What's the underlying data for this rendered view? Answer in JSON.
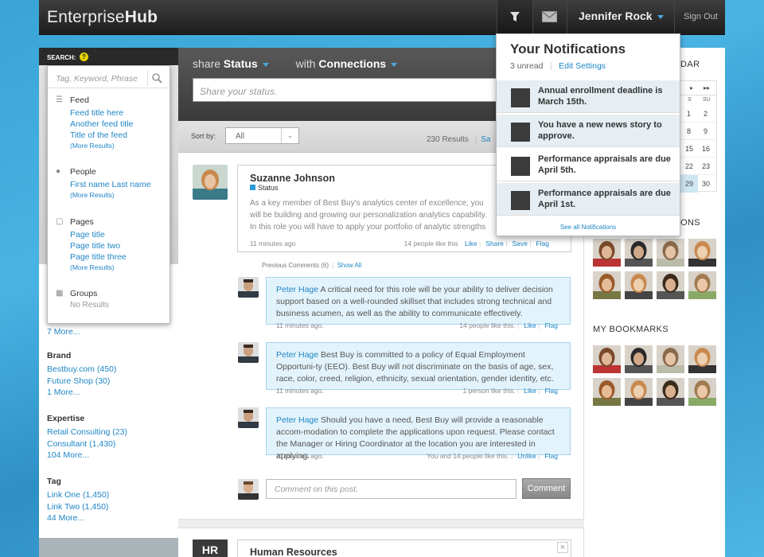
{
  "header": {
    "logo_light": "Enterprise",
    "logo_bold": "Hub",
    "user_name": "Jennifer Rock",
    "signout": "Sign Out",
    "icons": [
      "notifications-icon",
      "mail-icon"
    ]
  },
  "search": {
    "label": "SEARCH:",
    "help": "?",
    "placeholder": "Tag, Keyword, Phrase",
    "groups": [
      {
        "title": "Feed",
        "icon": "list-icon",
        "items": [
          "Feed title here",
          "Another feed title",
          "Title of the feed"
        ],
        "more": "(More Results)"
      },
      {
        "title": "People",
        "icon": "person-icon",
        "items": [
          "First name Last name"
        ],
        "more": "(More Results)"
      },
      {
        "title": "Pages",
        "icon": "page-icon",
        "items": [
          "Page title",
          "Page title two",
          "Page title three"
        ],
        "more": "(More Results)"
      },
      {
        "title": "Groups",
        "icon": "grid-icon",
        "no_results": "No Results"
      }
    ]
  },
  "facets": {
    "prev_more": "7 More...",
    "brand": {
      "title": "Brand",
      "items": [
        "Bestbuy.com (450)",
        "Future Shop (30)",
        "1 More..."
      ]
    },
    "expertise": {
      "title": "Expertise",
      "items": [
        "Retail Consulting (23)",
        "Consultant (1,430)",
        "104 More..."
      ]
    },
    "tag": {
      "title": "Tag",
      "items": [
        "Link One (1,450)",
        "Link Two (1,450)",
        "44 More..."
      ]
    }
  },
  "share": {
    "tab1_light": "share",
    "tab1_bold": "Status",
    "tab2_light": "with",
    "tab2_bold": "Connections",
    "placeholder": "Share your status."
  },
  "sort": {
    "label": "Sort by:",
    "value": "All",
    "results": "230 Results",
    "save": "Sa"
  },
  "post": {
    "author": "Suzanne Johnson",
    "type": "Status",
    "body": "As a key member of Best Buy's analytics center of excellence, you will be building and growing our personalization analytics capability. In this role you will have to apply your portfolio of analytic strengths and well healed consulting skills.",
    "time": "11 minutes ago",
    "likes": "14 people like this",
    "actions": [
      "Like",
      "Share",
      "Save",
      "Flag"
    ],
    "prev_comments": "Previous Comments (6)",
    "show_all": "Show All"
  },
  "comments": [
    {
      "author": "Peter Hage",
      "text": "A critical need for this role will be your ability to deliver decision support based on a well-rounded skillset that includes strong technical and business acumen, as well as the ability to communicate effectively.",
      "time": "11 minutes ago.",
      "likes": "14 people like this.",
      "actions": [
        "Like",
        "Flag"
      ]
    },
    {
      "author": "Peter Hage",
      "text": "Best Buy is committed to a policy of Equal Employment Opportuni-ty (EEO). Best Buy will not discriminate on the basis of age, sex, race, color, creed, religion, ethnicity, sexual orientation, gender identity, etc.",
      "time": "11 minutes ago.",
      "likes": "1 person like this.",
      "actions": [
        "Like",
        "Flag"
      ]
    },
    {
      "author": "Peter Hage",
      "text": "Should you have a need, Best Buy will provide a reasonable accom-modation to complete the applications upon request. Please contact the Manager or Hiring Coordinator at the location you are interested in applying.",
      "time": "11 minutes ago.",
      "likes": "You and 14 people like this.",
      "actions": [
        "Unlike",
        "Flag"
      ]
    }
  ],
  "comment_input": {
    "placeholder": "Comment on this post.",
    "button": "Comment"
  },
  "next_post": {
    "badge": "HR",
    "title": "Human Resources",
    "close": "×"
  },
  "calendar": {
    "title": "DAR",
    "nav": [
      "▸",
      "▸▸"
    ],
    "days": [
      "S",
      "SU"
    ],
    "rows": [
      [
        "1",
        "2"
      ],
      [
        "8",
        "9"
      ],
      [
        "15",
        "16"
      ],
      [
        "22",
        "23"
      ],
      [
        "29",
        "30"
      ]
    ]
  },
  "connections_title": "ONS",
  "bookmarks_title": "MY BOOKMARKS",
  "notifications": {
    "title": "Your Notifications",
    "unread": "3 unread",
    "edit": "Edit Settings",
    "items": [
      "Annual enrollment deadline is March 15th.",
      "You have a  new news story to approve.",
      "Performance appraisals are due April 5th.",
      "Performance appraisals are due April 1st."
    ],
    "see_all": "See all Notifications"
  },
  "colors": {
    "accent": "#1f86c6",
    "bg_blue": "#3aa4d8",
    "comment_bg": "#e3f3fb"
  }
}
